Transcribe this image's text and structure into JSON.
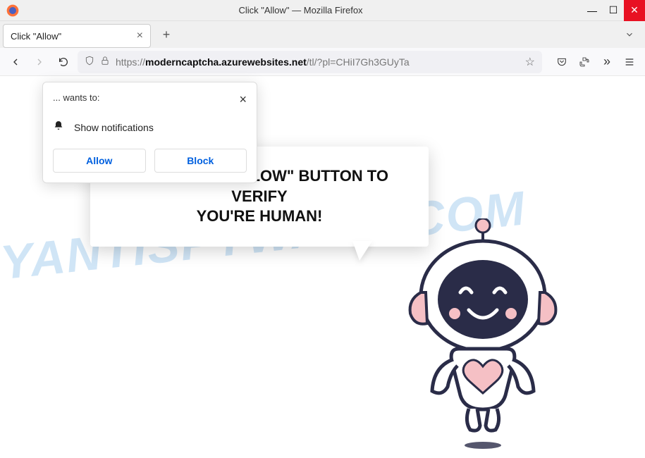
{
  "window": {
    "title": "Click \"Allow\" — Mozilla Firefox"
  },
  "tab": {
    "title": "Click \"Allow\""
  },
  "url": {
    "protocol": "https://",
    "domain": "moderncaptcha.azurewebsites.net",
    "path": "/tl/?pl=CHiI7Gh3GUyTa"
  },
  "permission": {
    "wants": "... wants to:",
    "body": "Show notifications",
    "allow": "Allow",
    "block": "Block"
  },
  "speech": {
    "line1": "PRESS THE \"ALLOW\" BUTTON TO VERIFY",
    "line2": "YOU'RE HUMAN!"
  },
  "watermark": "MYANTISPYWARE.COM",
  "colors": {
    "close_bg": "#e81123",
    "firefox_blue": "#0060df",
    "robot_dark": "#2a2c48",
    "robot_pink": "#f5c0c5"
  }
}
